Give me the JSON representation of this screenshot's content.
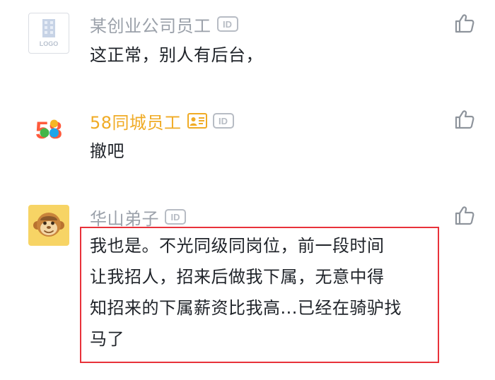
{
  "comments": [
    {
      "user": "某创业公司员工",
      "id_badge": "ID",
      "avatar_text": "LOGO",
      "text": "这正常，别人有后台，"
    },
    {
      "user": "58同城员工",
      "id_badge": "ID",
      "avatar_text": "58",
      "text": "撤吧"
    },
    {
      "user": "华山弟子",
      "id_badge": "ID",
      "text_lines": [
        "我也是。不光同级同岗位，前一段时间",
        "让我招人，招来后做我下属，无意中得",
        "知招来的下属薪资比我高...已经在骑驴找",
        "马了"
      ]
    }
  ],
  "colors": {
    "name_gray": "#9ba1aa",
    "name_highlight": "#f0ab25",
    "text": "#1f2329",
    "highlight_border": "#e8323a",
    "icon_gray": "#8e949c"
  },
  "icons": {
    "like": "thumbs-up-icon",
    "verified": "id-card-icon"
  }
}
